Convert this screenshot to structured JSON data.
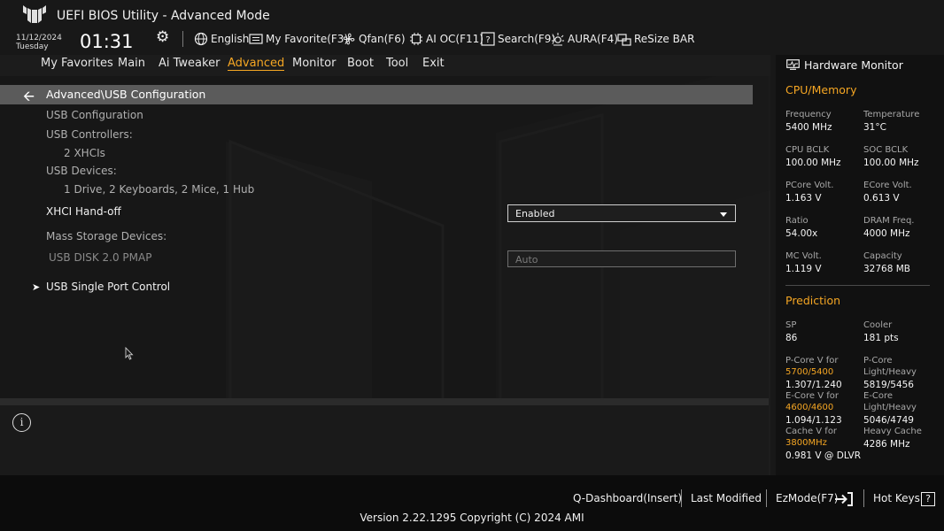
{
  "header": {
    "title": "UEFI BIOS Utility - Advanced Mode",
    "date": "11/12/2024",
    "weekday": "Tuesday",
    "time": "01:31",
    "tools": [
      {
        "label": "English",
        "icon": "globe-icon"
      },
      {
        "label": "My Favorite(F3)",
        "icon": "favorite-icon"
      },
      {
        "label": "Qfan(F6)",
        "icon": "fan-icon"
      },
      {
        "label": "AI OC(F11)",
        "icon": "chip-icon"
      },
      {
        "label": "Search(F9)",
        "icon": "search-icon"
      },
      {
        "label": "AURA(F4)",
        "icon": "aura-icon"
      },
      {
        "label": "ReSize BAR",
        "icon": "resize-bar-icon"
      }
    ]
  },
  "menu": {
    "items": [
      "My Favorites",
      "Main",
      "Ai Tweaker",
      "Advanced",
      "Monitor",
      "Boot",
      "Tool",
      "Exit"
    ],
    "active": "Advanced"
  },
  "main": {
    "breadcrumb": "Advanced\\USB Configuration",
    "usb_configuration": "USB Configuration",
    "usb_controllers_label": "USB Controllers:",
    "usb_controllers_value": "2 XHCIs",
    "usb_devices_label": "USB Devices:",
    "usb_devices_value": "1 Drive, 2 Keyboards, 2 Mice, 1 Hub",
    "xhci_label": "XHCI Hand-off",
    "xhci_value": "Enabled",
    "mass_storage_label": "Mass Storage Devices:",
    "usb_disk_label": "USB DISK 2.0 PMAP",
    "usb_disk_value": "Auto",
    "single_port_label": "USB Single Port Control"
  },
  "hw_monitor": {
    "title": "Hardware Monitor",
    "cpu_memory_title": "CPU/Memory",
    "cpu": [
      {
        "label": "Frequency",
        "value": "5400 MHz"
      },
      {
        "label": "Temperature",
        "value": "31°C"
      },
      {
        "label": "CPU BCLK",
        "value": "100.00 MHz"
      },
      {
        "label": "SOC BCLK",
        "value": "100.00 MHz"
      },
      {
        "label": "PCore Volt.",
        "value": "1.163 V"
      },
      {
        "label": "ECore Volt.",
        "value": "0.613 V"
      },
      {
        "label": "Ratio",
        "value": "54.00x"
      },
      {
        "label": "DRAM Freq.",
        "value": "4000 MHz"
      },
      {
        "label": "MC Volt.",
        "value": "1.119 V"
      },
      {
        "label": "Capacity",
        "value": "32768 MB"
      }
    ],
    "prediction_title": "Prediction",
    "sp_label": "SP",
    "sp_value": "86",
    "cooler_label": "Cooler",
    "cooler_value": "181 pts",
    "pcore_v_label": "P-Core V for",
    "pcore_v_freq": "5700/5400",
    "pcore_v_value": "1.307/1.240",
    "pcore_lh_label_1": "P-Core",
    "pcore_lh_label_2": "Light/Heavy",
    "pcore_lh_value": "5819/5456",
    "ecore_v_label": "E-Core V for",
    "ecore_v_freq": "4600/4600",
    "ecore_v_value": "1.094/1.123",
    "ecore_lh_label_1": "E-Core",
    "ecore_lh_label_2": "Light/Heavy",
    "ecore_lh_value": "5046/4749",
    "cache_v_label": "Cache V for",
    "cache_v_freq": "3800MHz",
    "cache_v_value": "0.981 V @ DLVR",
    "heavy_cache_label": "Heavy Cache",
    "heavy_cache_value": "4286 MHz"
  },
  "footer": {
    "qdashboard": "Q-Dashboard(Insert)",
    "last_modified": "Last Modified",
    "ezmode": "EzMode(F7)",
    "hotkeys": "Hot Keys",
    "hotkeys_glyph": "?",
    "version": "Version 2.22.1295 Copyright (C) 2024 AMI"
  },
  "colors": {
    "accent": "#f5a623",
    "background": "#181818",
    "breadcrumb_bar": "#5b5b5b"
  }
}
